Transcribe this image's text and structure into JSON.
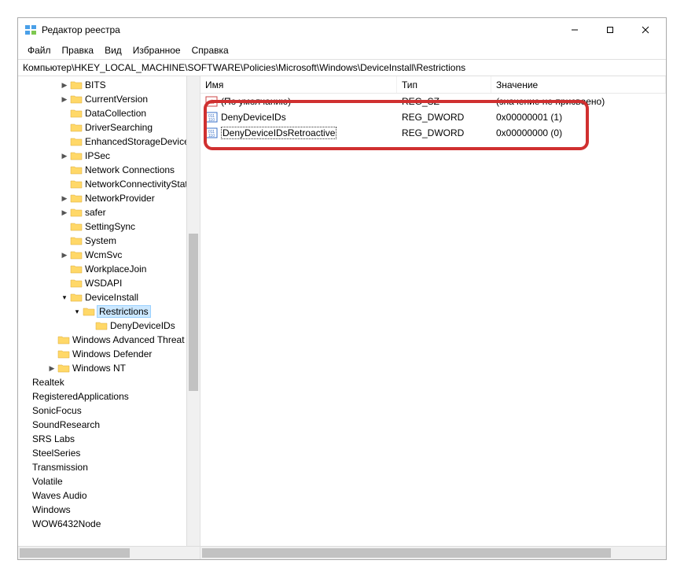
{
  "window": {
    "title": "Редактор реестра"
  },
  "menu": {
    "file": "Файл",
    "edit": "Правка",
    "view": "Вид",
    "favorites": "Избранное",
    "help": "Справка"
  },
  "addressbar": "Компьютер\\HKEY_LOCAL_MACHINE\\SOFTWARE\\Policies\\Microsoft\\Windows\\DeviceInstall\\Restrictions",
  "tree": [
    {
      "indent": 3,
      "exp": ">",
      "label": "BITS",
      "icon": true
    },
    {
      "indent": 3,
      "exp": ">",
      "label": "CurrentVersion",
      "icon": true
    },
    {
      "indent": 3,
      "exp": "",
      "label": "DataCollection",
      "icon": true
    },
    {
      "indent": 3,
      "exp": "",
      "label": "DriverSearching",
      "icon": true
    },
    {
      "indent": 3,
      "exp": "",
      "label": "EnhancedStorageDevices",
      "icon": true
    },
    {
      "indent": 3,
      "exp": ">",
      "label": "IPSec",
      "icon": true
    },
    {
      "indent": 3,
      "exp": "",
      "label": "Network Connections",
      "icon": true
    },
    {
      "indent": 3,
      "exp": "",
      "label": "NetworkConnectivityStatusIndicator",
      "icon": true
    },
    {
      "indent": 3,
      "exp": ">",
      "label": "NetworkProvider",
      "icon": true
    },
    {
      "indent": 3,
      "exp": ">",
      "label": "safer",
      "icon": true
    },
    {
      "indent": 3,
      "exp": "",
      "label": "SettingSync",
      "icon": true
    },
    {
      "indent": 3,
      "exp": "",
      "label": "System",
      "icon": true
    },
    {
      "indent": 3,
      "exp": ">",
      "label": "WcmSvc",
      "icon": true
    },
    {
      "indent": 3,
      "exp": "",
      "label": "WorkplaceJoin",
      "icon": true
    },
    {
      "indent": 3,
      "exp": "",
      "label": "WSDAPI",
      "icon": true
    },
    {
      "indent": 3,
      "exp": "v",
      "label": "DeviceInstall",
      "icon": true
    },
    {
      "indent": 4,
      "exp": "v",
      "label": "Restrictions",
      "icon": true,
      "selected": true
    },
    {
      "indent": 5,
      "exp": "",
      "label": "DenyDeviceIDs",
      "icon": true
    },
    {
      "indent": 2,
      "exp": "",
      "label": "Windows Advanced Threat Protection",
      "icon": true
    },
    {
      "indent": 2,
      "exp": "",
      "label": "Windows Defender",
      "icon": true
    },
    {
      "indent": 2,
      "exp": ">",
      "label": "Windows NT",
      "icon": true
    },
    {
      "indent": 0,
      "exp": "",
      "label": "Realtek",
      "icon": false
    },
    {
      "indent": 0,
      "exp": "",
      "label": "RegisteredApplications",
      "icon": false
    },
    {
      "indent": 0,
      "exp": "",
      "label": "SonicFocus",
      "icon": false
    },
    {
      "indent": 0,
      "exp": "",
      "label": "SoundResearch",
      "icon": false
    },
    {
      "indent": 0,
      "exp": "",
      "label": "SRS Labs",
      "icon": false
    },
    {
      "indent": 0,
      "exp": "",
      "label": "SteelSeries",
      "icon": false
    },
    {
      "indent": 0,
      "exp": "",
      "label": "Transmission",
      "icon": false
    },
    {
      "indent": 0,
      "exp": "",
      "label": "Volatile",
      "icon": false
    },
    {
      "indent": 0,
      "exp": "",
      "label": "Waves Audio",
      "icon": false
    },
    {
      "indent": 0,
      "exp": "",
      "label": "Windows",
      "icon": false
    },
    {
      "indent": 0,
      "exp": "",
      "label": "WOW6432Node",
      "icon": false
    }
  ],
  "columns": {
    "name": "Имя",
    "type": "Тип",
    "value": "Значение"
  },
  "values": [
    {
      "name": "(По умолчанию)",
      "type": "REG_SZ",
      "data": "(значение не присвоено)",
      "iconType": "sz",
      "editing": false
    },
    {
      "name": "DenyDeviceIDs",
      "type": "REG_DWORD",
      "data": "0x00000001 (1)",
      "iconType": "dword",
      "editing": false
    },
    {
      "name": "DenyDeviceIDsRetroactive",
      "type": "REG_DWORD",
      "data": "0x00000000 (0)",
      "iconType": "dword",
      "editing": true
    }
  ]
}
